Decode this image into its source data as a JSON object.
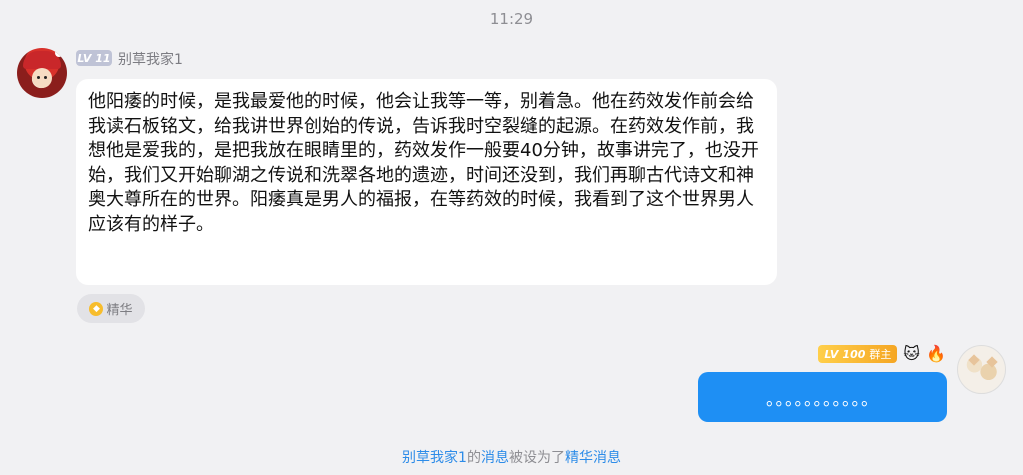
{
  "chat": {
    "timestamp": "11:29",
    "incoming": {
      "level_badge": "LV 11",
      "sender_name": "别草我家1",
      "text": "他阳痿的时候，是我最爱他的时候，他会让我等一等，别着急。他在药效发作前会给我读石板铭文，给我讲世界创始的传说，告诉我时空裂缝的起源。在药效发作前，我想他是爱我的，是把我放在眼睛里的，药效发作一般要40分钟，故事讲完了，也没开始，我们又开始聊湖之传说和洗翠各地的遗迹，时间还没到，我们再聊古代诗文和神奥大尊所在的世界。阳痿真是男人的福报，在等药效的时候，我看到了这个世界男人应该有的样子。",
      "essence_label": "精华",
      "essence_icon": "diamond-icon"
    },
    "outgoing": {
      "level_label": "LV",
      "level_number": "100",
      "role_label": "群主",
      "text": "。。。。。。。。。。。"
    },
    "system_notice": {
      "sender": "别草我家1",
      "mid1": "的",
      "link1": "消息",
      "mid2": "被设为了",
      "link2": "精华消息"
    }
  },
  "colors": {
    "background": "#f1f1f3",
    "incoming_bubble": "#ffffff",
    "outgoing_bubble": "#1e8ff4",
    "link": "#2d8ce8",
    "gold_badge": "#f5a623"
  }
}
